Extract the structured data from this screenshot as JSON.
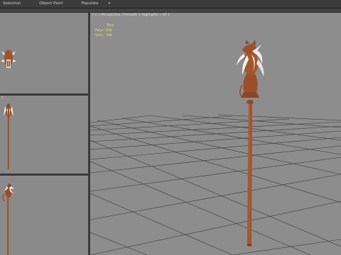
{
  "menubar": {
    "items": [
      "Selection",
      "Object Paint",
      "Populate"
    ],
    "dropdown_glyph": "▾"
  },
  "viewports": {
    "main": {
      "label": "[ + ] [Perspective ] [Smooth + Highlights + HF ]",
      "stats": [
        {
          "label": "Total",
          "value": ""
        },
        {
          "label": "Polys:",
          "value": "400"
        },
        {
          "label": "Verts:",
          "value": "798"
        }
      ]
    },
    "left_middle": {
      "label": "["
    }
  },
  "colors": {
    "viewport_bg": "#8a8a8a",
    "grid_line": "#3a3a3a",
    "staff_wood": "#a0532b",
    "stats_text": "#e8e36a"
  }
}
